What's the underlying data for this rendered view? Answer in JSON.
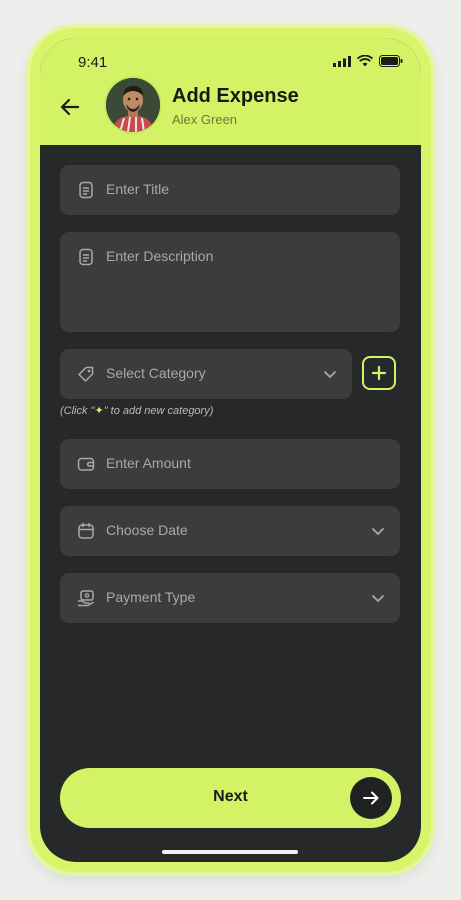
{
  "status_bar": {
    "time": "9:41"
  },
  "header": {
    "title": "Add Expense",
    "user_name": "Alex Green"
  },
  "form": {
    "title_placeholder": "Enter Title",
    "description_placeholder": "Enter Description",
    "category_placeholder": "Select Category",
    "category_hint_prefix": "(Click \"",
    "category_hint_icon": "✦",
    "category_hint_suffix": "\" to add new category)",
    "amount_placeholder": "Enter Amount",
    "date_placeholder": "Choose Date",
    "payment_placeholder": "Payment Type"
  },
  "actions": {
    "next_label": "Next"
  },
  "icons": {
    "back": "arrow-left-icon",
    "document": "document-icon",
    "tag": "tag-icon",
    "wallet": "wallet-icon",
    "calendar": "calendar-icon",
    "payment": "payment-icon",
    "chevron": "chevron-down-icon",
    "plus": "plus-icon",
    "arrow_right": "arrow-right-icon"
  },
  "colors": {
    "accent": "#d4f266",
    "background": "#262829",
    "field": "#3a3c3d",
    "placeholder": "#a7a9aa"
  }
}
